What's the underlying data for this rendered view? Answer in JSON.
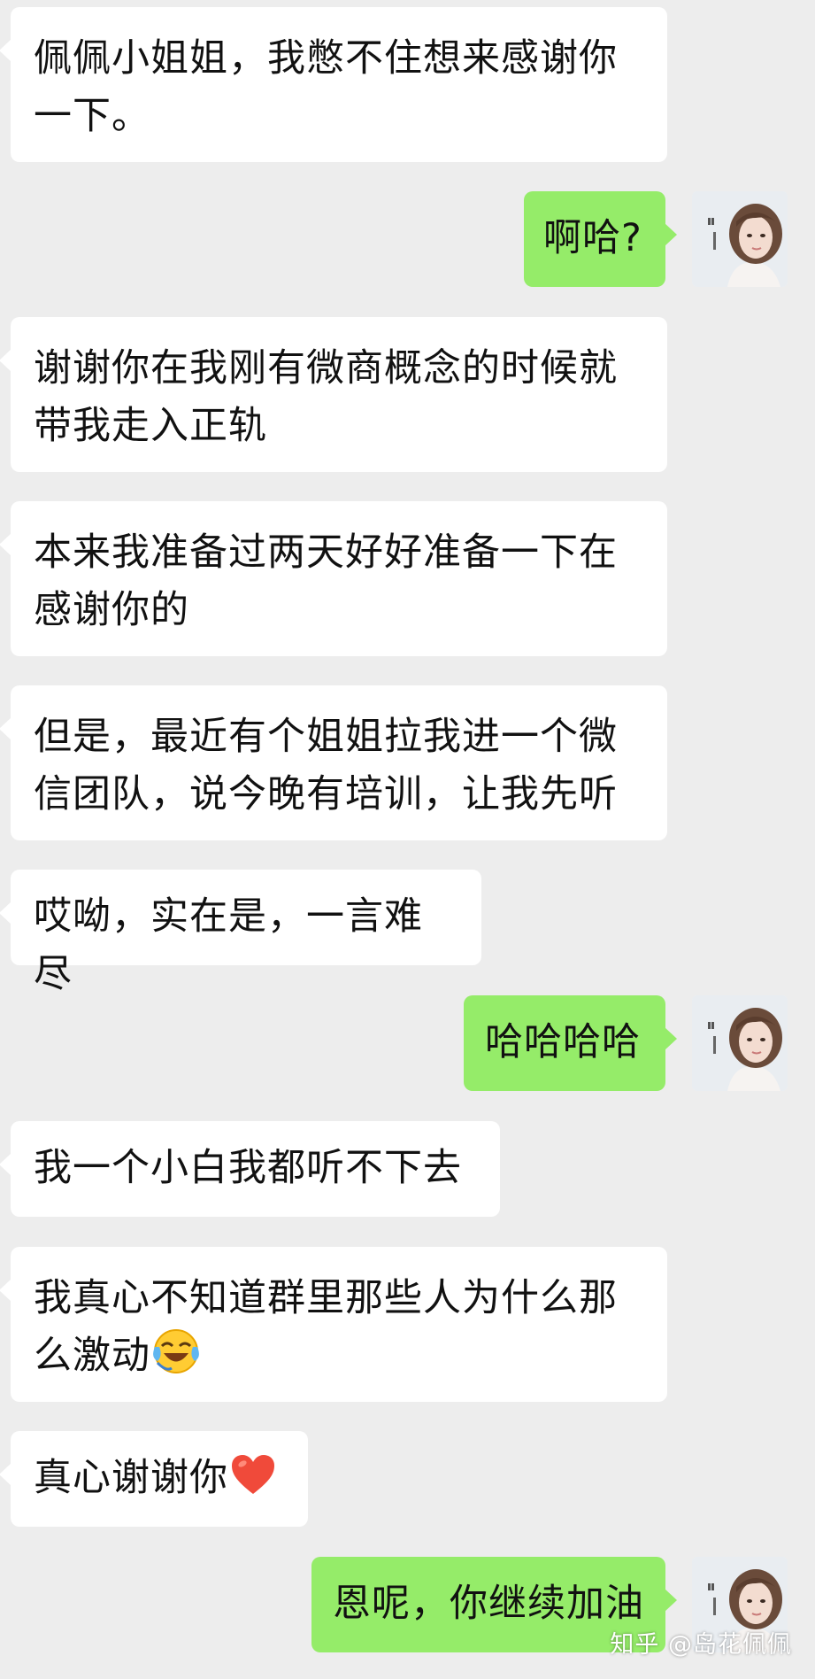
{
  "messages": [
    {
      "side": "in",
      "text": "佩佩小姐姐，我憋不住想来感谢你一下。"
    },
    {
      "side": "out",
      "text": "啊哈?"
    },
    {
      "side": "in",
      "text": "谢谢你在我刚有微商概念的时候就带我走入正轨"
    },
    {
      "side": "in",
      "text": "本来我准备过两天好好准备一下在感谢你的"
    },
    {
      "side": "in",
      "text": "但是，最近有个姐姐拉我进一个微信团队，说今晚有培训，让我先听"
    },
    {
      "side": "in",
      "text": "哎呦，实在是，一言难尽"
    },
    {
      "side": "out",
      "text": "哈哈哈哈"
    },
    {
      "side": "in",
      "text": "我一个小白我都听不下去"
    },
    {
      "side": "in",
      "text": "我真心不知道群里那些人为什么那么激动",
      "emoji": "crying-laughing-emoji"
    },
    {
      "side": "in",
      "text": "真心谢谢你",
      "emoji": "red-heart-emoji"
    },
    {
      "side": "out",
      "text": "恩呢，你继续加油"
    }
  ],
  "watermark": "知乎 @岛花佩佩",
  "colors": {
    "background": "#ededed",
    "incoming_bubble": "#ffffff",
    "outgoing_bubble": "#95ec69",
    "text": "#111111"
  }
}
